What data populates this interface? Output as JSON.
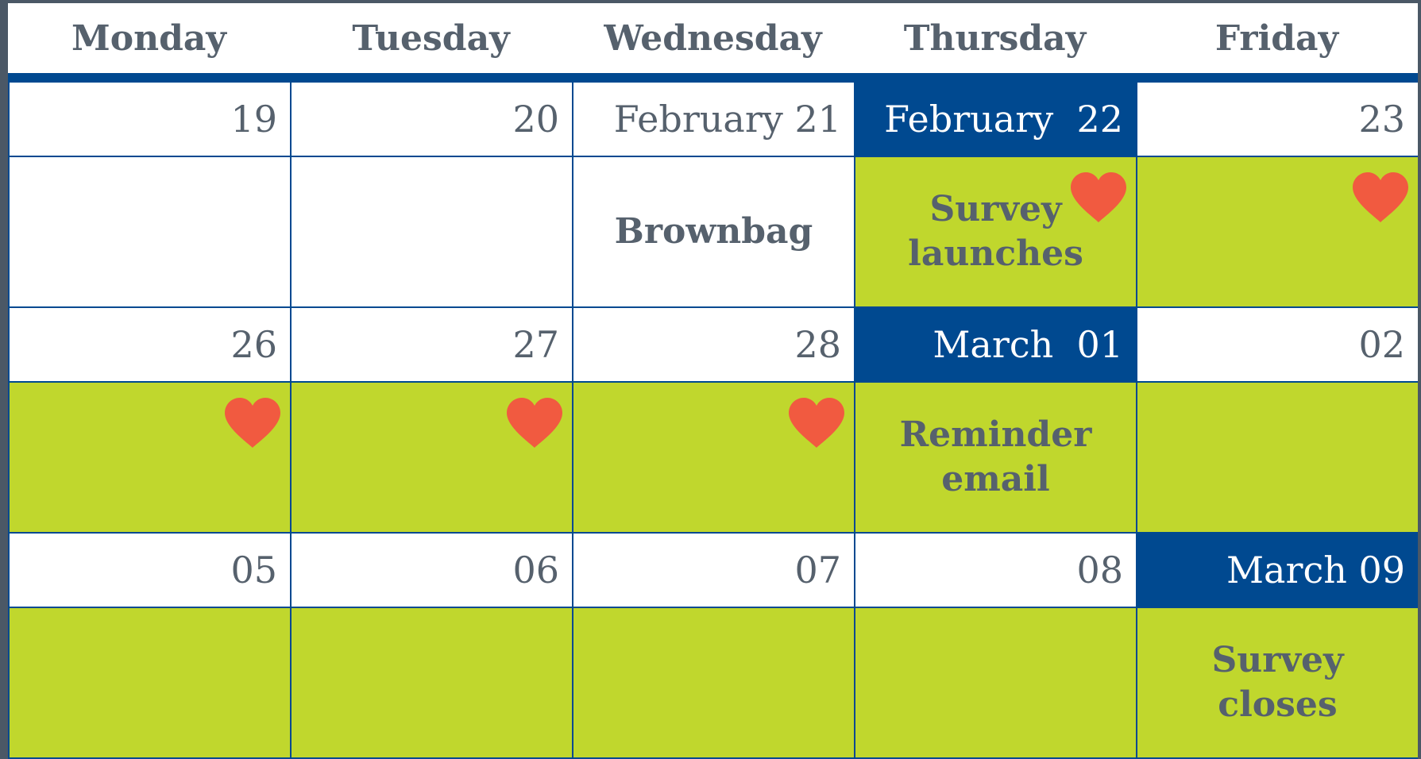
{
  "colors": {
    "navy": "#004990",
    "green": "#c0d72d",
    "text": "#56616d",
    "heart": "#f15a40"
  },
  "weekdays": [
    "Monday",
    "Tuesday",
    "Wednesday",
    "Thursday",
    "Friday"
  ],
  "weeks": [
    {
      "dates": [
        {
          "label": "19",
          "highlight": false
        },
        {
          "label": "20",
          "highlight": false
        },
        {
          "label": "February 21",
          "highlight": false
        },
        {
          "label": "February  22",
          "highlight": true
        },
        {
          "label": "23",
          "highlight": false
        }
      ],
      "events": [
        {
          "text": "",
          "green": false,
          "heart": false
        },
        {
          "text": "",
          "green": false,
          "heart": false
        },
        {
          "text": "Brownbag",
          "green": false,
          "heart": false
        },
        {
          "text": "Survey\nlaunches",
          "green": true,
          "heart": true
        },
        {
          "text": "",
          "green": true,
          "heart": true
        }
      ]
    },
    {
      "dates": [
        {
          "label": "26",
          "highlight": false
        },
        {
          "label": "27",
          "highlight": false
        },
        {
          "label": "28",
          "highlight": false
        },
        {
          "label": "March  01",
          "highlight": true
        },
        {
          "label": "02",
          "highlight": false
        }
      ],
      "events": [
        {
          "text": "",
          "green": true,
          "heart": true
        },
        {
          "text": "",
          "green": true,
          "heart": true
        },
        {
          "text": "",
          "green": true,
          "heart": true
        },
        {
          "text": "Reminder\nemail",
          "green": true,
          "heart": false
        },
        {
          "text": "",
          "green": true,
          "heart": false
        }
      ]
    },
    {
      "dates": [
        {
          "label": "05",
          "highlight": false
        },
        {
          "label": "06",
          "highlight": false
        },
        {
          "label": "07",
          "highlight": false
        },
        {
          "label": "08",
          "highlight": false
        },
        {
          "label": "March 09",
          "highlight": true
        }
      ],
      "events": [
        {
          "text": "",
          "green": true,
          "heart": false
        },
        {
          "text": "",
          "green": true,
          "heart": false
        },
        {
          "text": "",
          "green": true,
          "heart": false
        },
        {
          "text": "",
          "green": true,
          "heart": false
        },
        {
          "text": "Survey\ncloses",
          "green": true,
          "heart": false
        }
      ]
    }
  ]
}
